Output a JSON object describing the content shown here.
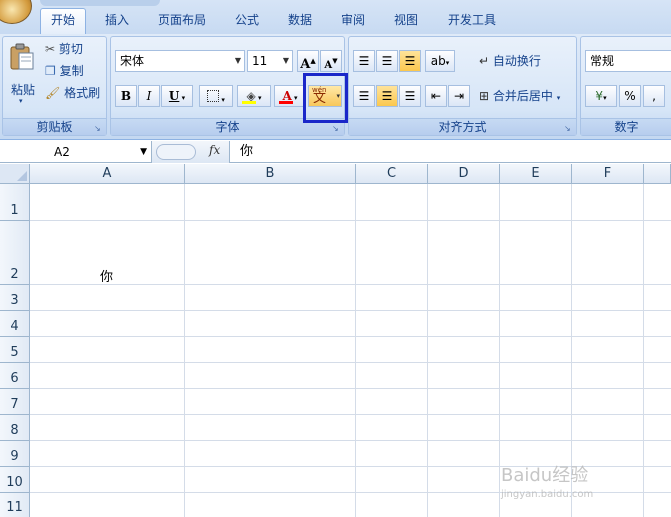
{
  "tabs": [
    {
      "label": "开始",
      "active": true
    },
    {
      "label": "插入"
    },
    {
      "label": "页面布局"
    },
    {
      "label": "公式"
    },
    {
      "label": "数据"
    },
    {
      "label": "审阅"
    },
    {
      "label": "视图"
    },
    {
      "label": "开发工具"
    }
  ],
  "clipboard": {
    "paste_label": "粘贴",
    "cut_label": "剪切",
    "copy_label": "复制",
    "format_painter_label": "格式刷",
    "group_label": "剪贴板"
  },
  "font": {
    "font_name": "宋体",
    "font_size": "11",
    "bold": "B",
    "italic": "I",
    "underline": "U",
    "grow_font": "A",
    "shrink_font": "A",
    "font_color_letter": "A",
    "phonetic_top": "wén",
    "phonetic_char": "文",
    "group_label": "字体"
  },
  "alignment": {
    "wrap_text_label": "自动换行",
    "merge_center_label": "合并后居中",
    "group_label": "对齐方式"
  },
  "number": {
    "format_value": "常规",
    "percent": "%",
    "comma": ",",
    "group_label": "数字"
  },
  "formula_bar": {
    "name_box": "A2",
    "fx": "fx",
    "content": "你"
  },
  "columns": [
    "A",
    "B",
    "C",
    "D",
    "E",
    "F"
  ],
  "rows": [
    "1",
    "2",
    "3",
    "4",
    "5",
    "6",
    "7",
    "8",
    "9",
    "10",
    "11"
  ],
  "cells": {
    "A2": "你"
  },
  "watermark": {
    "brand": "Baidu经验",
    "url": "jingyan.baidu.com"
  },
  "colors": {
    "accent_frame": "#1a27c9",
    "ribbon_text": "#15428b",
    "active_alignment": "#fbd26a"
  }
}
